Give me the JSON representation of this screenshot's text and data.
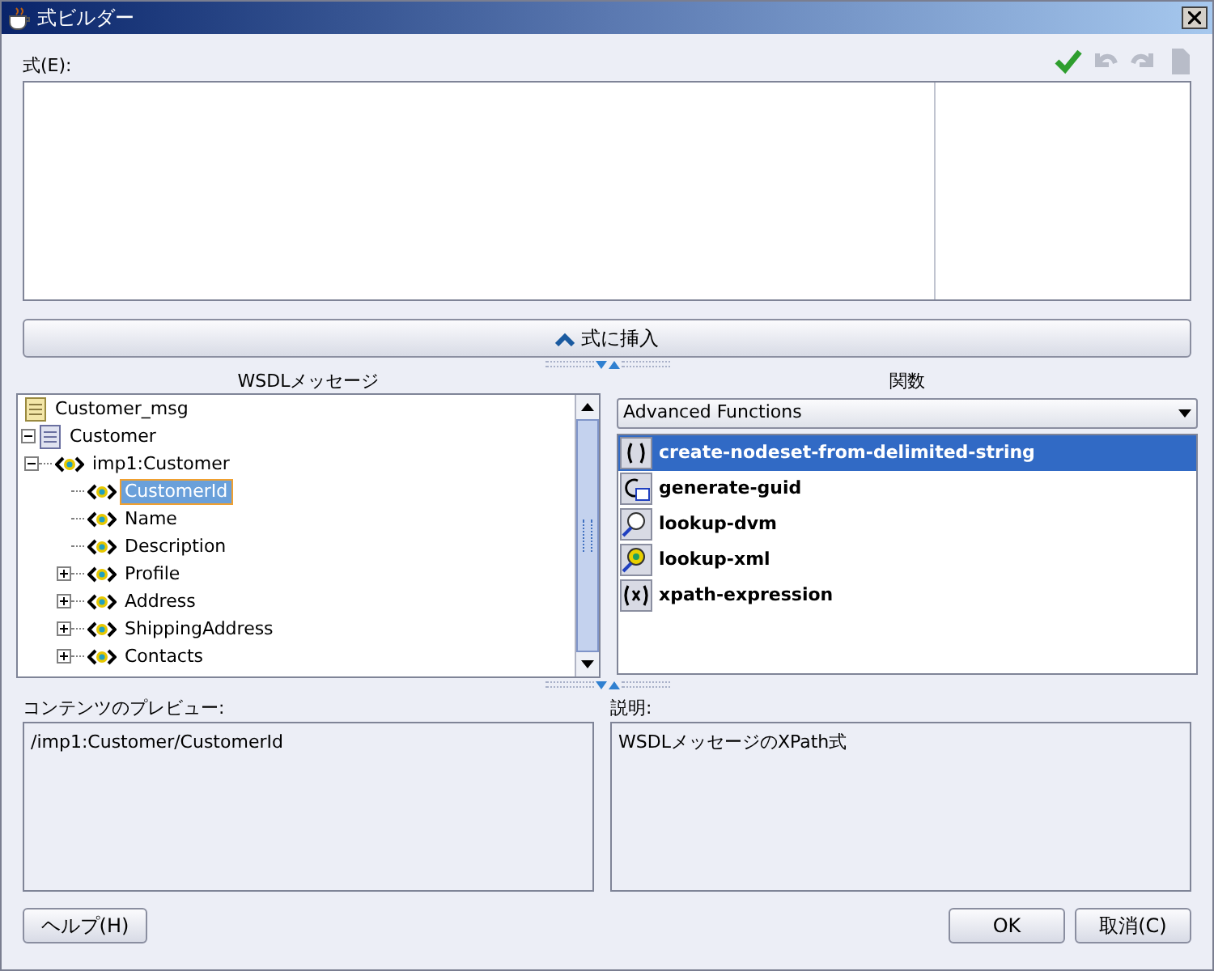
{
  "window": {
    "title": "式ビルダー"
  },
  "expression": {
    "label": "式(E):"
  },
  "toolbar": [
    {
      "kind": "check",
      "disabled": false
    },
    {
      "kind": "undo",
      "disabled": true
    },
    {
      "kind": "redo",
      "disabled": true
    },
    {
      "kind": "doc",
      "disabled": true
    }
  ],
  "insert_button": "式に挿入",
  "wsdl": {
    "title": "WSDLメッセージ",
    "tree": [
      {
        "label": "Customer_msg",
        "kind": "message",
        "selected": false
      },
      {
        "label": "Customer",
        "kind": "part",
        "selected": false,
        "expanded": true,
        "children": [
          {
            "label": "imp1:Customer",
            "kind": "element",
            "selected": false,
            "expanded": true,
            "children": [
              {
                "label": "CustomerId",
                "kind": "element",
                "selected": true
              },
              {
                "label": "Name",
                "kind": "element",
                "selected": false
              },
              {
                "label": "Description",
                "kind": "element",
                "selected": false
              },
              {
                "label": "Profile",
                "kind": "element",
                "selected": false,
                "expanded": false
              },
              {
                "label": "Address",
                "kind": "element",
                "selected": false,
                "expanded": false
              },
              {
                "label": "ShippingAddress",
                "kind": "element",
                "selected": false,
                "expanded": false
              },
              {
                "label": "Contacts",
                "kind": "element",
                "selected": false,
                "expanded": false
              }
            ]
          }
        ]
      }
    ]
  },
  "functions": {
    "title": "関数",
    "category": "Advanced Functions",
    "items": [
      {
        "label": "create-nodeset-from-delimited-string",
        "kind": "function",
        "selected": true
      },
      {
        "label": "generate-guid",
        "kind": "guid",
        "selected": false
      },
      {
        "label": "lookup-dvm",
        "kind": "dvm",
        "selected": false
      },
      {
        "label": "lookup-xml",
        "kind": "xml",
        "selected": false
      },
      {
        "label": "xpath-expression",
        "kind": "xpath",
        "selected": false
      }
    ]
  },
  "preview": {
    "label": "コンテンツのプレビュー:",
    "value": "/imp1:Customer/CustomerId"
  },
  "description": {
    "label": "説明:",
    "value": "WSDLメッセージのXPath式"
  },
  "buttons": {
    "help": "ヘルプ(H)",
    "ok": "OK",
    "cancel": "取消(C)"
  }
}
